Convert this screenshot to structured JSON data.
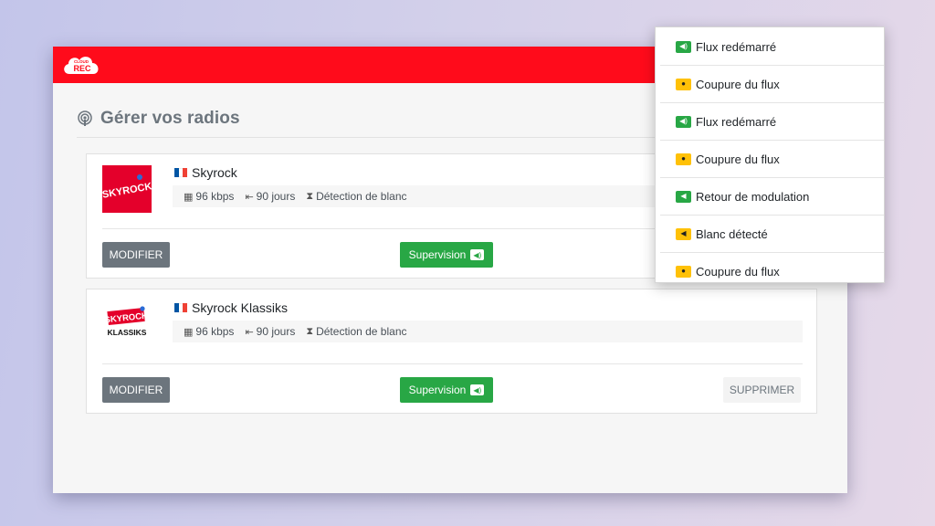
{
  "app": {
    "logo_text_top": "CLOUD",
    "logo_text_main": "REC"
  },
  "page": {
    "title": "Gérer vos radios"
  },
  "radios": [
    {
      "name": "Skyrock",
      "logo_label": "SKYROCK",
      "bitrate": "96 kbps",
      "retention": "90 jours",
      "detection": "Détection de blanc",
      "modify_label": "MODIFIER",
      "supervision_label": "Supervision"
    },
    {
      "name": "Skyrock Klassiks",
      "logo_label": "SKYROCK",
      "logo_sub": "KLASSIKS",
      "bitrate": "96 kbps",
      "retention": "90 jours",
      "detection": "Détection de blanc",
      "modify_label": "MODIFIER",
      "supervision_label": "Supervision",
      "delete_label": "SUPPRIMER"
    }
  ],
  "notifications": [
    {
      "label": "Flux redémarré",
      "type": "success",
      "icon": "speaker-icon"
    },
    {
      "label": "Coupure du flux",
      "type": "warning",
      "icon": "alert-icon"
    },
    {
      "label": "Flux redémarré",
      "type": "success",
      "icon": "speaker-icon"
    },
    {
      "label": "Coupure du flux",
      "type": "warning",
      "icon": "alert-icon"
    },
    {
      "label": "Retour de modulation",
      "type": "success",
      "icon": "speaker-low-icon"
    },
    {
      "label": "Blanc détecté",
      "type": "warning",
      "icon": "speaker-low-icon"
    },
    {
      "label": "Coupure du flux",
      "type": "warning",
      "icon": "alert-icon"
    }
  ],
  "colors": {
    "brand_red": "#ff0b1b",
    "success": "#28a745",
    "warning": "#ffc107",
    "secondary": "#6c757d"
  }
}
